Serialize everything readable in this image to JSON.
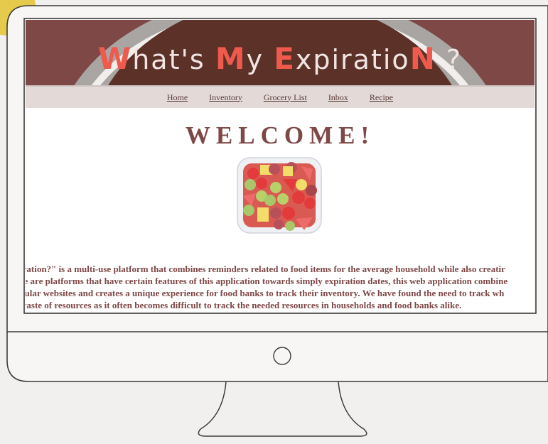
{
  "app": {
    "title_parts": [
      {
        "text": "W",
        "cap": true
      },
      {
        "text": "hat's ",
        "cap": false
      },
      {
        "text": "M",
        "cap": true
      },
      {
        "text": "y ",
        "cap": false
      },
      {
        "text": "E",
        "cap": true
      },
      {
        "text": "xpiratio",
        "cap": false
      },
      {
        "text": "N",
        "cap": true
      },
      {
        "text": " ?",
        "cap": false
      }
    ]
  },
  "nav": {
    "items": [
      "Home",
      "Inventory",
      "Grocery List",
      "Inbox",
      "Recipe"
    ]
  },
  "main": {
    "heading": "WELCOME!",
    "intro_lines": [
      "iration?\" is a multi-use platform that combines reminders related to food items for the average household while also creatir",
      "re are platforms that have certain features of this application towards simply expiration dates, this web application combine",
      "gular websites and creates a unique experience for food banks to track their inventory. We have found the need to track wh",
      "waste of resources as it often becomes difficult to track the needed resources in households and food banks alike."
    ]
  },
  "colors": {
    "banner_dark": "#5c3128",
    "banner_side": "#7d4846",
    "arc_gray": "#a8a5a2",
    "accent_red": "#f05a4d",
    "text_maroon": "#7d4846"
  }
}
